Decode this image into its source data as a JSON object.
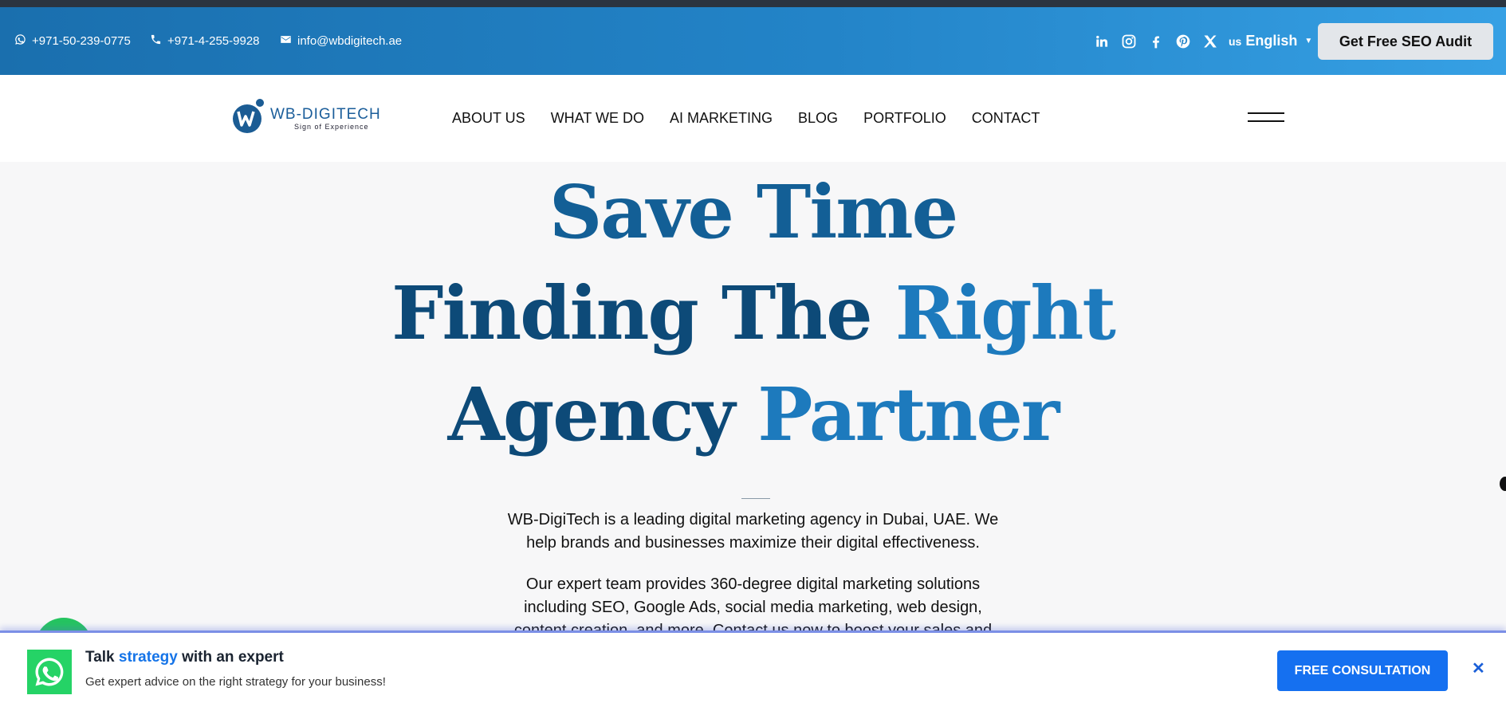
{
  "topbar": {
    "whatsapp": "+971-50-239-0775",
    "phone": "+971-4-255-9928",
    "email": "info@wbdigitech.ae",
    "social_icons": [
      "linkedin-icon",
      "instagram-icon",
      "facebook-icon",
      "pinterest-icon",
      "x-icon"
    ],
    "language_flag": "us",
    "language": "English",
    "audit_button": "Get Free SEO Audit"
  },
  "nav": {
    "logo_name": "WB-DIGITECH",
    "logo_tagline": "Sign of Experience",
    "items": [
      "ABOUT US",
      "WHAT WE DO",
      "AI MARKETING",
      "BLOG",
      "PORTFOLIO",
      "CONTACT"
    ]
  },
  "hero": {
    "line1": "Save Time",
    "line2_a": "Finding The",
    "line2_b": "Right",
    "line3_a": "Agency",
    "line3_b": "Partner",
    "para1_l1": "WB-DigiTech is a leading digital marketing agency in Dubai, UAE. We",
    "para1_l2": "help brands and businesses maximize their digital effectiveness.",
    "para2_l1": "Our expert team provides 360-degree digital marketing solutions",
    "para2_l2": "including SEO, Google Ads, social media marketing, web design,",
    "para2_l3": "content creation, and more. Contact us now to boost your sales and"
  },
  "banner": {
    "title_pre": "Talk",
    "title_accent": "strategy",
    "title_post": "with an expert",
    "subtitle": "Get expert advice on the right strategy for your business!",
    "button": "FREE CONSULTATION",
    "close": "✕"
  },
  "colors": {
    "topbar_start": "#1a6fae",
    "topbar_end": "#36a0e4",
    "headline_dark": "#0d4a78",
    "headline_bright": "#1d7abd",
    "cta_blue": "#1570f0",
    "whatsapp_green": "#25d366"
  }
}
